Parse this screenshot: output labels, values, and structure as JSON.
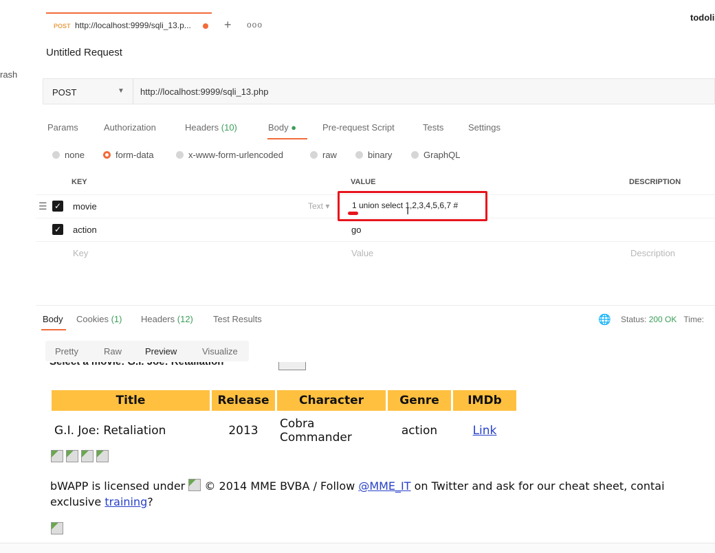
{
  "sidebar": {
    "trash_label": "rash"
  },
  "workspace": {
    "user": "todoli"
  },
  "tab": {
    "method": "POST",
    "url": "http://localhost:9999/sqli_13.p..."
  },
  "request": {
    "title": "Untitled Request",
    "method": "POST",
    "url": "http://localhost:9999/sqli_13.php",
    "tabs": {
      "params": "Params",
      "authorization": "Authorization",
      "headers": "Headers",
      "headers_count": "(10)",
      "body": "Body",
      "prerequest": "Pre-request Script",
      "tests": "Tests",
      "settings": "Settings"
    },
    "body_modes": [
      "none",
      "form-data",
      "x-www-form-urlencoded",
      "raw",
      "binary",
      "GraphQL"
    ],
    "table_headers": {
      "key": "KEY",
      "value": "VALUE",
      "description": "DESCRIPTION"
    },
    "rows": [
      {
        "key": "movie",
        "type": "Text",
        "value": "1 union select 1,2,3,4,5,6,7 #"
      },
      {
        "key": "action",
        "value": "go"
      }
    ],
    "placeholders": {
      "key": "Key",
      "value": "Value",
      "description": "Description"
    }
  },
  "response": {
    "tabs": {
      "body": "Body",
      "cookies": "Cookies",
      "cookies_count": "(1)",
      "headers": "Headers",
      "headers_count": "(12)",
      "tests": "Test Results"
    },
    "status_label": "Status:",
    "status_value": "200 OK",
    "time_label": "Time:",
    "views": [
      "Pretty",
      "Raw",
      "Preview",
      "Visualize"
    ]
  },
  "preview": {
    "clipped_text": "Select a movie: G.I. Joe: Retaliation",
    "columns": [
      "Title",
      "Release",
      "Character",
      "Genre",
      "IMDb"
    ],
    "row": {
      "title": "G.I. Joe: Retaliation",
      "release": "2013",
      "character_line1": "Cobra",
      "character_line2": "Commander",
      "genre": "action",
      "imdb": "Link"
    },
    "footer": {
      "part1": "bWAPP is licensed under ",
      "part2": " © 2014 MME BVBA / Follow ",
      "twitter": "@MME_IT",
      "part3": " on Twitter and ask for our cheat sheet, contai",
      "part4": "exclusive ",
      "training": "training",
      "part5": "?"
    }
  }
}
